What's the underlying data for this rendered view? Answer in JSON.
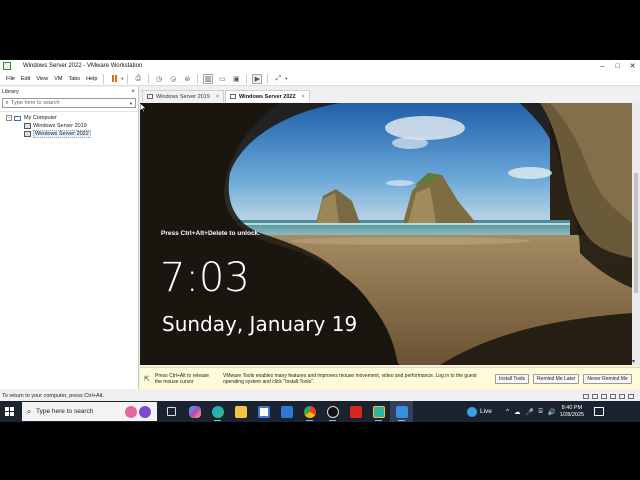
{
  "window": {
    "title": "Windows Server 2022 - VMware Workstation"
  },
  "menu": [
    "File",
    "Edit",
    "View",
    "VM",
    "Tabs",
    "Help"
  ],
  "library": {
    "title": "Library",
    "search_placeholder": "Type here to search",
    "tree": {
      "root": "My Computer",
      "items": [
        "Windows Server 2019",
        "Windows Server 2022"
      ],
      "selected": "Windows Server 2022"
    }
  },
  "tabs": [
    {
      "label": "Windows Server 2019",
      "active": false
    },
    {
      "label": "Windows Server 2022",
      "active": true
    }
  ],
  "lockscreen": {
    "hint": "Press Ctrl+Alt+Delete to unlock.",
    "time": "7:03",
    "date": "Sunday, January 19"
  },
  "toolsbar": {
    "release_message": "Press Ctrl+Alt to release the mouse cursor",
    "tools_message": "VMware Tools enables many features and improves mouse movement, video and performance. Log in to the guest operating system and click \"Install Tools\".",
    "buttons": [
      "Install Tools",
      "Remind Me Later",
      "Never Remind Me"
    ]
  },
  "statusbar": {
    "message": "To return to your computer, press Ctrl+Alt."
  },
  "taskbar": {
    "search_placeholder": "Type here to search",
    "live_label": "Live",
    "clock_time": "8:40 PM",
    "clock_date": "1/28/2025"
  },
  "colors": {
    "taskbar_bg": "#1c2330",
    "tools_bar_bg": "#fefcd8",
    "pause_accent": "#e06a1a"
  },
  "icons": {
    "taskbar_apps": [
      "task-view-icon",
      "copilot-icon",
      "edge-icon",
      "file-explorer-icon",
      "store-icon",
      "mail-icon",
      "chrome-icon",
      "obs-icon",
      "acrobat-icon",
      "file-manager-icon",
      "vmware-icon"
    ]
  }
}
